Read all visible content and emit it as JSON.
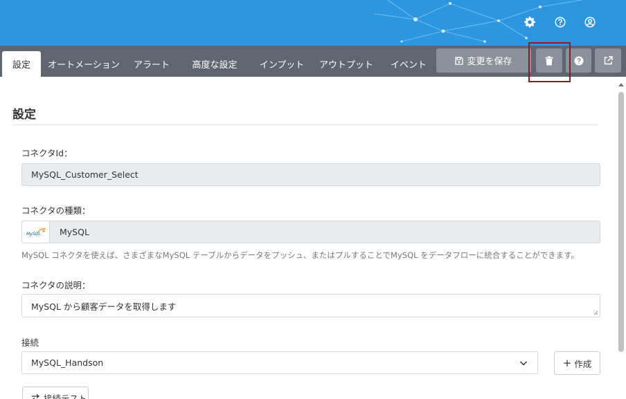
{
  "header": {
    "icons": [
      "gear-icon",
      "help-circle-icon",
      "user-circle-icon"
    ],
    "brand_color": "#2d96e1"
  },
  "tabs": [
    {
      "label": "設定",
      "active": true
    },
    {
      "label": "オートメーション",
      "active": false
    },
    {
      "label": "アラート",
      "active": false
    },
    {
      "label": "高度な設定",
      "active": false
    },
    {
      "label": "インプット",
      "active": false
    },
    {
      "label": "アウトプット",
      "active": false
    },
    {
      "label": "イベント",
      "active": false
    }
  ],
  "toolbar": {
    "save_label": "変更を保存",
    "delete_icon": "trash-icon",
    "help_icon": "help-circle-icon",
    "open_icon": "external-link-icon"
  },
  "form": {
    "section_title": "設定",
    "connector_id": {
      "label": "コネクタId：",
      "value": "MySQL_Customer_Select"
    },
    "connector_type": {
      "label": "コネクタの種類：",
      "value": "MySQL",
      "logo_text": "MySQL",
      "help": "MySQL コネクタを使えば、さまざまなMySQL テーブルからデータをプッシュ、またはプルすることでMySQL をデータフローに統合することができます。"
    },
    "description": {
      "label": "コネクタの説明：",
      "value": "MySQL から顧客データを取得します"
    },
    "connection": {
      "label": "接続",
      "value": "MySQL_Handson",
      "create_label": "作成"
    },
    "test_label": "接続テスト"
  }
}
